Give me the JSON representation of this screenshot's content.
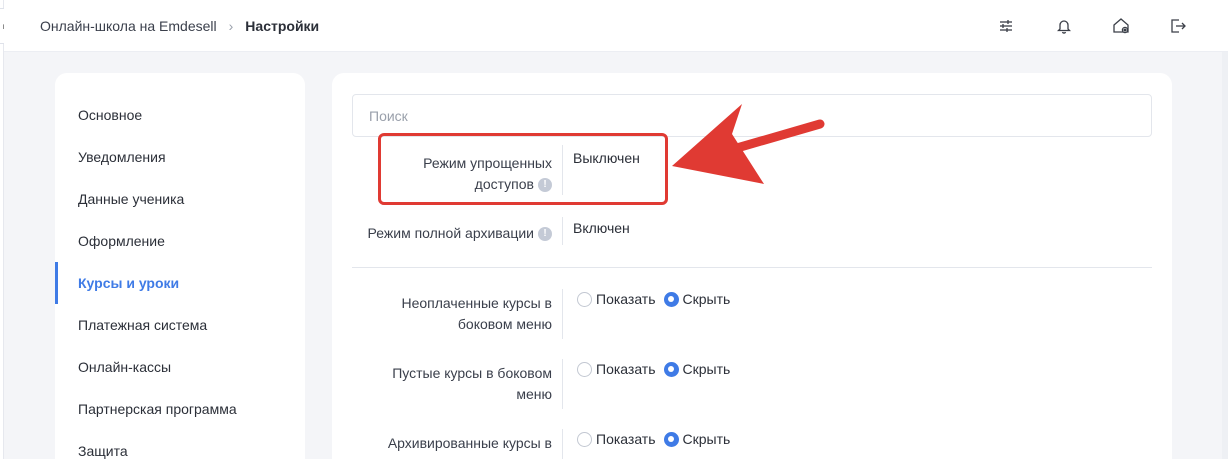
{
  "topbar": {
    "breadcrumb": {
      "parent": "Онлайн-школа на Emdesell",
      "separator": "›",
      "current": "Настройки"
    },
    "icons": [
      "sliders-icon",
      "bell-icon",
      "home-settings-icon",
      "logout-icon"
    ]
  },
  "collapse_button": {
    "glyph": "⇤"
  },
  "sidebar": {
    "active_index": 4,
    "items": [
      {
        "label": "Основное"
      },
      {
        "label": "Уведомления"
      },
      {
        "label": "Данные ученика"
      },
      {
        "label": "Оформление"
      },
      {
        "label": "Курсы и уроки"
      },
      {
        "label": "Платежная система"
      },
      {
        "label": "Онлайн-кассы"
      },
      {
        "label": "Партнерская программа"
      },
      {
        "label": "Защита"
      }
    ]
  },
  "main": {
    "search": {
      "placeholder": "Поиск",
      "value": ""
    },
    "settings": [
      {
        "label_line1": "Режим упрощенных",
        "label_line2": "доступов",
        "value": "Выключен"
      },
      {
        "label": "Режим полной архивации",
        "value": "Включен"
      }
    ],
    "toggles": [
      {
        "label_line1": "Неоплаченные курсы в",
        "label_line2": "боковом меню",
        "option_show": "Показать",
        "option_hide": "Скрыть",
        "selected": "hide"
      },
      {
        "label_line1": "Пустые курсы в боковом",
        "label_line2": "меню",
        "option_show": "Показать",
        "option_hide": "Скрыть",
        "selected": "hide"
      },
      {
        "label_line1": "Архивированные курсы в",
        "label_line2": "",
        "option_show": "Показать",
        "option_hide": "Скрыть",
        "selected": "hide"
      }
    ]
  },
  "colors": {
    "accent": "#3f7be6",
    "annotation": "#e03a33",
    "background": "#f4f5f8"
  }
}
